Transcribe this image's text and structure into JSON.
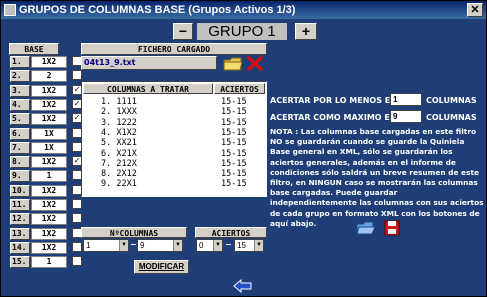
{
  "window": {
    "title": "GRUPOS DE COLUMNAS BASE  (Grupos Activos 1/3)",
    "close_glyph": "✕"
  },
  "group_nav": {
    "minus_label": "−",
    "plus_label": "+",
    "group_name": "GRUPO 1"
  },
  "base": {
    "header": "BASE",
    "rows": [
      {
        "num": "1.",
        "value": "1X2",
        "checked": false
      },
      {
        "num": "2.",
        "value": "2",
        "checked": false
      },
      {
        "num": "3.",
        "value": "1X2",
        "checked": true
      },
      {
        "num": "4.",
        "value": "1X2",
        "checked": true
      },
      {
        "num": "5.",
        "value": "1X2",
        "checked": true
      },
      {
        "num": "6.",
        "value": "1X",
        "checked": false
      },
      {
        "num": "7.",
        "value": "1X",
        "checked": false
      },
      {
        "num": "8.",
        "value": "1X2",
        "checked": true
      },
      {
        "num": "9.",
        "value": "1",
        "checked": false
      },
      {
        "num": "10.",
        "value": "1X2",
        "checked": false
      },
      {
        "num": "11.",
        "value": "1X2",
        "checked": false
      },
      {
        "num": "12.",
        "value": "1X2",
        "checked": false
      },
      {
        "num": "13.",
        "value": "1X2",
        "checked": false
      },
      {
        "num": "14.",
        "value": "1X2",
        "checked": false
      },
      {
        "num": "15.",
        "value": "1",
        "checked": false
      }
    ]
  },
  "fichero": {
    "header": "FICHERO CARGADO",
    "filename": "04t13_9.txt"
  },
  "columnas": {
    "header_col": "COLUMNAS A TRATAR",
    "header_aciertos": "ACIERTOS",
    "rows": [
      {
        "idx": "1.",
        "col": "1111",
        "aciertos": "15-15"
      },
      {
        "idx": "2.",
        "col": "1XXX",
        "aciertos": "15-15"
      },
      {
        "idx": "3.",
        "col": "1222",
        "aciertos": "15-15"
      },
      {
        "idx": "4.",
        "col": "X1X2",
        "aciertos": "15-15"
      },
      {
        "idx": "5.",
        "col": "XX21",
        "aciertos": "15-15"
      },
      {
        "idx": "6.",
        "col": "X21X",
        "aciertos": "15-15"
      },
      {
        "idx": "7.",
        "col": "212X",
        "aciertos": "15-15"
      },
      {
        "idx": "8.",
        "col": "2X12",
        "aciertos": "15-15"
      },
      {
        "idx": "9.",
        "col": "22X1",
        "aciertos": "15-15"
      }
    ]
  },
  "acertar": {
    "min_label": "ACERTAR POR LO MENOS EN",
    "min_value": "1",
    "max_label": "ACERTAR COMO MAXIMO EN",
    "max_value": "9",
    "suffix": "COLUMNAS"
  },
  "note": "NOTA : Las columnas base cargadas en este filtro NO se guardarán cuando se guarde la Quiniela Base general en XML, sólo se guardarán los aciertos generales, además en el informe de condiciones sólo saldrá un breve resumen de este filtro, en NINGUN caso se mostrarán las columnas base cargadas. Puede guardar independientemente las columnas con sus aciertos de cada grupo en formato XML con los botones de aquí abajo.",
  "ncolumnas": {
    "header": "NºCOLUMNAS",
    "from": "1",
    "to": "9",
    "dash": "−"
  },
  "aciertos_sel": {
    "header": "ACIERTOS",
    "from": "0",
    "to": "15",
    "dash": "−"
  },
  "modificar_label": "MODIFICAR",
  "icons": {
    "folder": "folder-icon",
    "delete": "red-x-icon",
    "open": "open-folder-icon",
    "save": "save-disk-icon",
    "back": "back-arrow-icon"
  }
}
